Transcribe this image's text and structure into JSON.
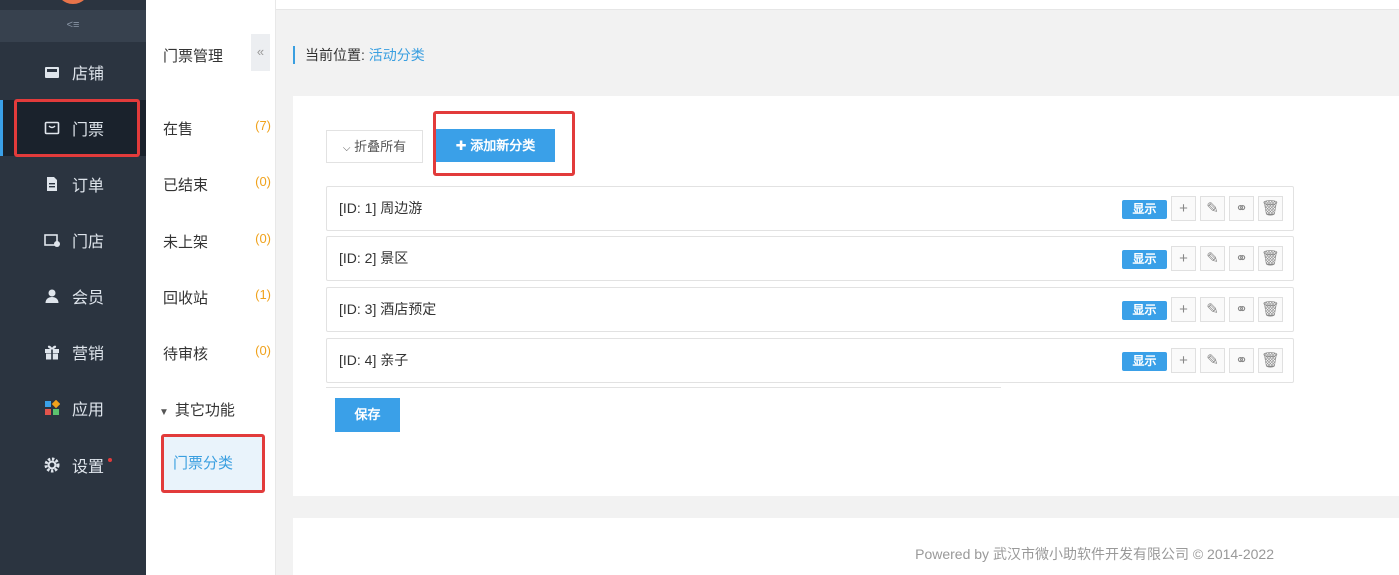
{
  "sidebar": {
    "collapse_icon": "collapse-menu-icon",
    "items": [
      {
        "label": "店铺",
        "icon": "store-icon"
      },
      {
        "label": "门票",
        "icon": "ticket-icon"
      },
      {
        "label": "订单",
        "icon": "order-icon"
      },
      {
        "label": "门店",
        "icon": "shop-icon"
      },
      {
        "label": "会员",
        "icon": "user-icon"
      },
      {
        "label": "营销",
        "icon": "gift-icon"
      },
      {
        "label": "应用",
        "icon": "apps-icon"
      },
      {
        "label": "设置",
        "icon": "gear-icon"
      }
    ],
    "active_index": 1
  },
  "subnav": {
    "title": "门票管理",
    "fold_glyph": "«",
    "items": [
      {
        "label": "在售",
        "count": "(7)"
      },
      {
        "label": "已结束",
        "count": "(0)"
      },
      {
        "label": "未上架",
        "count": "(0)"
      },
      {
        "label": "回收站",
        "count": "(1)"
      },
      {
        "label": "待审核",
        "count": "(0)"
      }
    ],
    "group_label": "其它功能",
    "active_item": "门票分类"
  },
  "breadcrumb": {
    "prefix": "当前位置:",
    "current": "活动分类"
  },
  "toolbar": {
    "fold_all": "折叠所有",
    "add_category": "添加新分类"
  },
  "categories": [
    {
      "label": "[ID: 1] 周边游",
      "status": "显示"
    },
    {
      "label": "[ID: 2] 景区",
      "status": "显示"
    },
    {
      "label": "[ID: 3] 酒店预定",
      "status": "显示"
    },
    {
      "label": "[ID: 4] 亲子",
      "status": "显示"
    }
  ],
  "save_label": "保存",
  "footer": {
    "text": "Powered by 武汉市微小助软件开发有限公司 © 2014-2022"
  },
  "colors": {
    "sidebar_bg": "#2b3440",
    "accent": "#3aa0e8",
    "highlight_box": "#e23b3b",
    "count": "#f0a21c"
  }
}
